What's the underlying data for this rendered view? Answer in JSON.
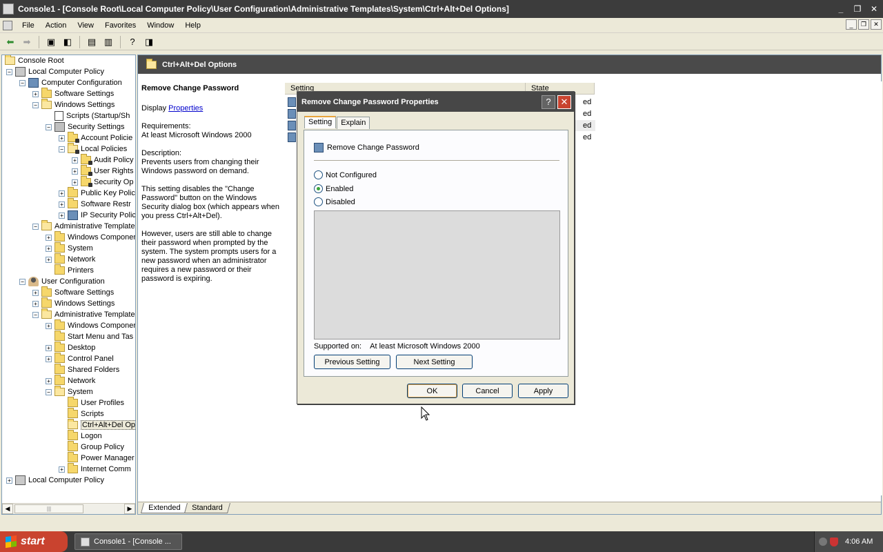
{
  "window": {
    "title": "Console1 - [Console Root\\Local Computer Policy\\User Configuration\\Administrative Templates\\System\\Ctrl+Alt+Del Options]"
  },
  "menu": [
    "File",
    "Action",
    "View",
    "Favorites",
    "Window",
    "Help"
  ],
  "tree": {
    "items": [
      {
        "label": "Console Root"
      },
      {
        "label": "Local Computer Policy"
      },
      {
        "label": "Computer Configuration"
      },
      {
        "label": "Software Settings"
      },
      {
        "label": "Windows Settings"
      },
      {
        "label": "Scripts (Startup/Sh"
      },
      {
        "label": "Security Settings"
      },
      {
        "label": "Account Policie"
      },
      {
        "label": "Local Policies"
      },
      {
        "label": "Audit Policy"
      },
      {
        "label": "User Rights"
      },
      {
        "label": "Security Op"
      },
      {
        "label": "Public Key Polici"
      },
      {
        "label": "Software Restr"
      },
      {
        "label": "IP Security Polic"
      },
      {
        "label": "Administrative Template"
      },
      {
        "label": "Windows Componer"
      },
      {
        "label": "System"
      },
      {
        "label": "Network"
      },
      {
        "label": "Printers"
      },
      {
        "label": "User Configuration"
      },
      {
        "label": "Software Settings"
      },
      {
        "label": "Windows Settings"
      },
      {
        "label": "Administrative Template"
      },
      {
        "label": "Windows Componer"
      },
      {
        "label": "Start Menu and Tas"
      },
      {
        "label": "Desktop"
      },
      {
        "label": "Control Panel"
      },
      {
        "label": "Shared Folders"
      },
      {
        "label": "Network"
      },
      {
        "label": "System"
      },
      {
        "label": "User Profiles"
      },
      {
        "label": "Scripts"
      },
      {
        "label": "Ctrl+Alt+Del Op"
      },
      {
        "label": "Logon"
      },
      {
        "label": "Group Policy"
      },
      {
        "label": "Power Manager"
      },
      {
        "label": "Internet Comm"
      },
      {
        "label": "Local Computer Policy"
      }
    ]
  },
  "header": {
    "title": "Ctrl+Alt+Del Options"
  },
  "description": {
    "title": "Remove Change Password",
    "display_prefix": "Display",
    "display_link": "Properties",
    "requirements_label": "Requirements:",
    "requirements_value": "At least Microsoft Windows 2000",
    "description_label": "Description:",
    "p1": "Prevents users from changing their Windows password on demand.",
    "p2": "This setting disables the \"Change Password\" button on the Windows Security dialog box (which appears when you press Ctrl+Alt+Del).",
    "p3": "However, users are still able to change their password when prompted by the system. The system prompts users for a new password when an administrator requires a new password or their password is expiring."
  },
  "list": {
    "columns": [
      "Setting",
      "State"
    ],
    "rows": [
      {
        "state": "ed"
      },
      {
        "state": "ed"
      },
      {
        "state": "ed"
      },
      {
        "state": "ed"
      }
    ]
  },
  "view_tabs": [
    "Extended",
    "Standard"
  ],
  "dialog": {
    "title": "Remove Change Password Properties",
    "help_glyph": "?",
    "close_glyph": "✕",
    "tabs": [
      "Setting",
      "Explain"
    ],
    "policy_name": "Remove Change Password",
    "options": [
      "Not Configured",
      "Enabled",
      "Disabled"
    ],
    "selected_option": "Enabled",
    "supported_label": "Supported on:",
    "supported_value": "At least Microsoft Windows 2000",
    "prev_button": "Previous Setting",
    "next_button": "Next Setting",
    "ok": "OK",
    "cancel": "Cancel",
    "apply": "Apply"
  },
  "taskbar": {
    "start": "start",
    "task": "Console1 - [Console ...",
    "clock": "4:06 AM"
  }
}
